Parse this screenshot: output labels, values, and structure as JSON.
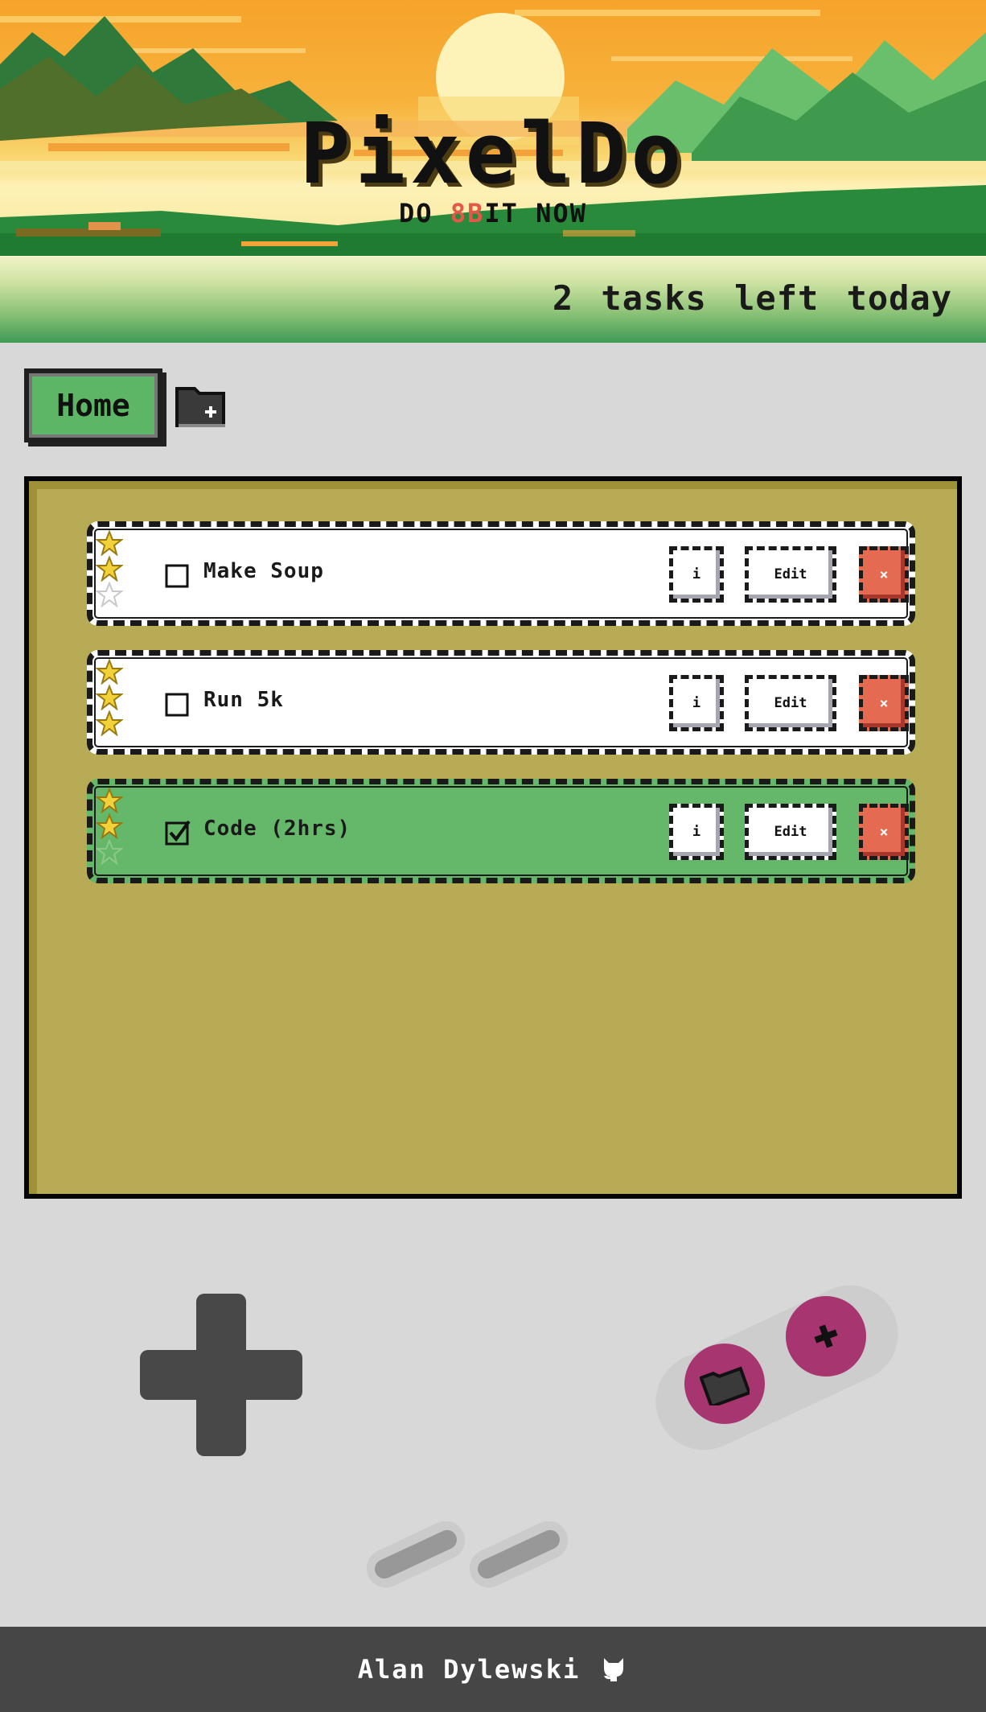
{
  "header": {
    "title": "PixelDo",
    "subtitle_prefix": "DO ",
    "subtitle_accent": "8B",
    "subtitle_suffix": "IT NOW",
    "accent_color": "#e4584a"
  },
  "status": {
    "tasks_left": "2 tasks left today"
  },
  "tabs": {
    "home_label": "Home",
    "new_folder_icon": "folder-plus-icon"
  },
  "tasks": [
    {
      "name": "Make Soup",
      "stars": 2,
      "max_stars": 3,
      "done": false,
      "info_label": "i",
      "edit_label": "Edit",
      "delete_label": "×"
    },
    {
      "name": "Run 5k",
      "stars": 3,
      "max_stars": 3,
      "done": false,
      "info_label": "i",
      "edit_label": "Edit",
      "delete_label": "×"
    },
    {
      "name": "Code (2hrs)",
      "stars": 2,
      "max_stars": 3,
      "done": true,
      "info_label": "i",
      "edit_label": "Edit",
      "delete_label": "×"
    }
  ],
  "controls": {
    "dpad_icon": "dpad-icon",
    "a_button_icon": "folder-icon",
    "b_button_icon": "plus-icon"
  },
  "footer": {
    "author": "Alan Dylewski",
    "link_icon": "github-icon"
  },
  "colors": {
    "screen": "#b8ab56",
    "done_task": "#65b769",
    "delete": "#e46b52",
    "button_magenta": "#a63570",
    "footer": "#464646"
  }
}
